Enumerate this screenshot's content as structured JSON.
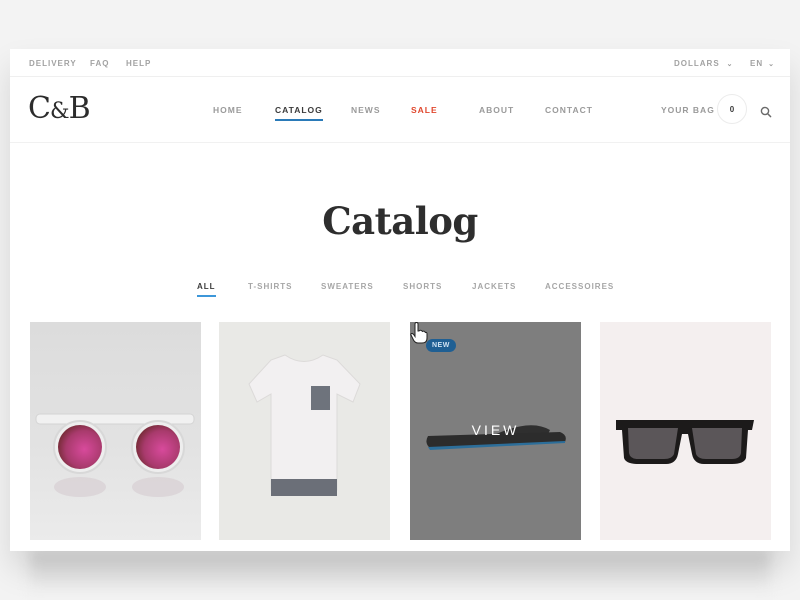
{
  "topbar": {
    "left_links": [
      "DELIVERY",
      "FAQ",
      "HELP"
    ],
    "currency": "DOLLARS",
    "language": "EN"
  },
  "header": {
    "logo": {
      "c": "C",
      "amp": "&",
      "b": "B"
    },
    "nav": [
      {
        "label": "HOME",
        "state": "default"
      },
      {
        "label": "CATALOG",
        "state": "active"
      },
      {
        "label": "NEWS",
        "state": "default"
      },
      {
        "label": "SALE",
        "state": "sale"
      },
      {
        "label": "ABOUT",
        "state": "default"
      },
      {
        "label": "CONTACT",
        "state": "default"
      }
    ],
    "bag_label": "YOUR BAG",
    "bag_count": "0",
    "search_icon": "search-icon"
  },
  "main": {
    "title": "Catalog",
    "filters": [
      {
        "label": "ALL",
        "active": true
      },
      {
        "label": "T-SHIRTS",
        "active": false
      },
      {
        "label": "SWEATERS",
        "active": false
      },
      {
        "label": "SHORTS",
        "active": false
      },
      {
        "label": "JACKETS",
        "active": false
      },
      {
        "label": "ACCESSOIRES",
        "active": false
      }
    ],
    "products": [
      {
        "item": "round clear-frame sunglasses with pink mirrored lenses",
        "badge": "",
        "hovered": false
      },
      {
        "item": "white t-shirt with grey pocket and hem",
        "badge": "",
        "hovered": false
      },
      {
        "item": "black flip-flop sandal",
        "badge": "NEW",
        "hovered": true,
        "hover_label": "VIEW"
      },
      {
        "item": "black wayfarer sunglasses",
        "badge": "",
        "hovered": false
      }
    ]
  },
  "colors": {
    "accent_blue": "#2a7ab8",
    "sale_red": "#e0472d",
    "badge_blue": "#1f5f93",
    "text_dark": "#2e2e2e",
    "text_muted": "#9a9a9a"
  }
}
